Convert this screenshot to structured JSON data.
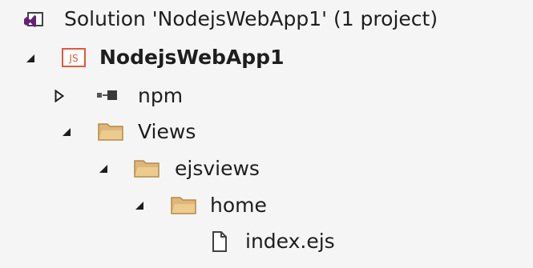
{
  "solution_explorer": {
    "solution_label": "Solution 'NodejsWebApp1' (1 project)",
    "project": {
      "label": "NodejsWebApp1",
      "icon": "js-project-icon",
      "expanded": true
    },
    "items": [
      {
        "label": "npm",
        "icon": "npm-icon",
        "expanded": false
      },
      {
        "label": "Views",
        "icon": "folder-icon",
        "expanded": true
      },
      {
        "label": "ejsviews",
        "icon": "folder-icon",
        "expanded": true
      },
      {
        "label": "home",
        "icon": "folder-icon",
        "expanded": true
      },
      {
        "label": "index.ejs",
        "icon": "file-icon"
      }
    ]
  },
  "colors": {
    "background": "#f5f5f5",
    "folder_fill": "#dcb67a",
    "js_badge": "#e05a3a",
    "solution_icon": "#68217a"
  }
}
